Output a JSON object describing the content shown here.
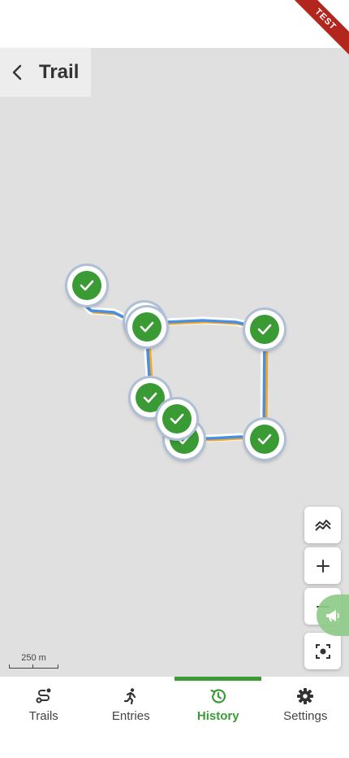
{
  "header": {
    "title": "Trail",
    "back_icon": "chevron-left-icon"
  },
  "ribbon": {
    "label": "TEST",
    "color": "#b3261e"
  },
  "map": {
    "background": "#e0e0e0",
    "route_colors": {
      "primary": "#4a90e2",
      "secondary": "#f5a623"
    },
    "checkpoint_count": 8,
    "checkpoint_status": "completed",
    "checkpoint_icon": "check-icon",
    "scale_label": "250 m",
    "controls": [
      {
        "name": "trail-toggle-button",
        "icon": "mountain-icon"
      },
      {
        "name": "zoom-in-button",
        "icon": "plus-icon"
      },
      {
        "name": "zoom-out-button",
        "icon": "minus-icon"
      },
      {
        "name": "recenter-button",
        "icon": "focus-icon"
      }
    ],
    "announce_icon": "megaphone-icon"
  },
  "nav": {
    "items": [
      {
        "label": "Trails",
        "icon": "route-icon"
      },
      {
        "label": "Entries",
        "icon": "runner-icon"
      },
      {
        "label": "History",
        "icon": "history-icon",
        "active": true
      },
      {
        "label": "Settings",
        "icon": "gear-icon"
      }
    ],
    "active_color": "#3a9b35"
  }
}
